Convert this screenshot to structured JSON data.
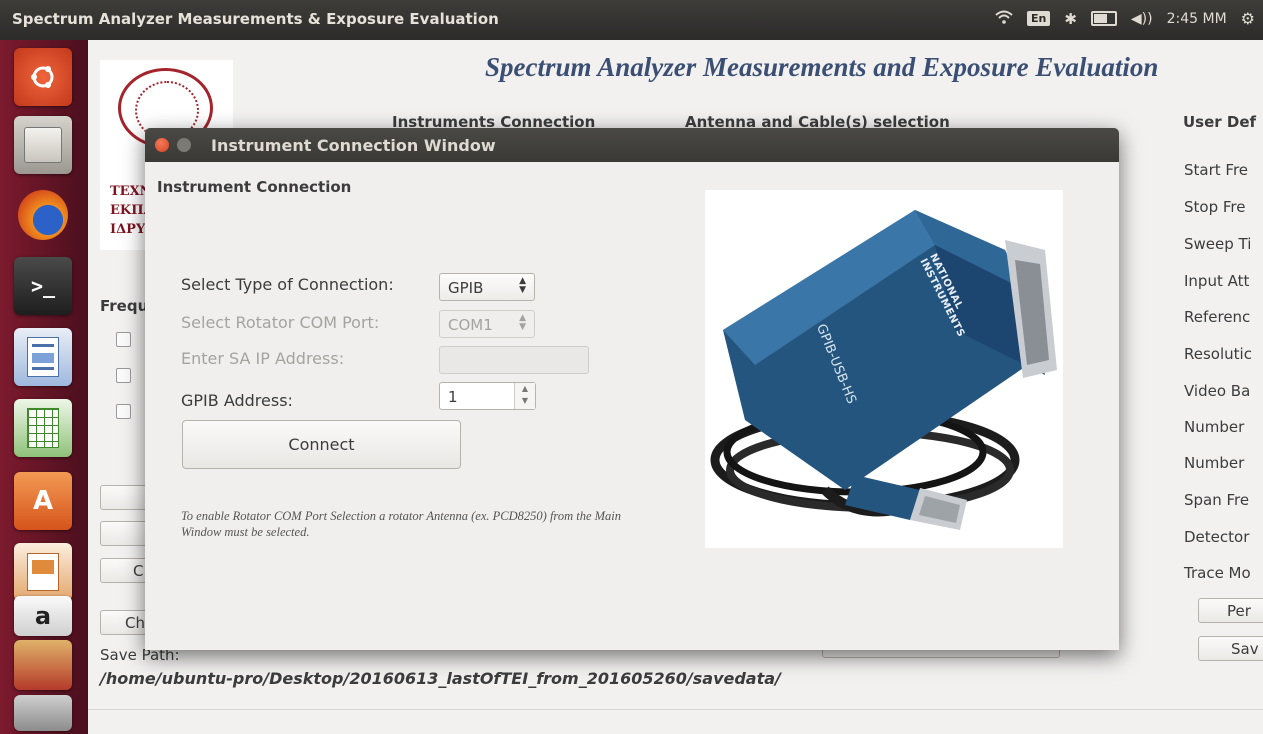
{
  "topbar": {
    "window_title": "Spectrum Analyzer Measurements & Exposure Evaluation",
    "keyboard_layout": "En",
    "clock": "2:45 MM"
  },
  "launcher": {
    "items": [
      "ubuntu-icon",
      "files-icon",
      "firefox-icon",
      "terminal-icon",
      "writer-icon",
      "calc-icon",
      "software-center-icon",
      "impress-icon",
      "amazon-icon",
      "stacked-apps-icon"
    ]
  },
  "main": {
    "title": "Spectrum Analyzer Measurements and Exposure Evaluation",
    "logo_lines": [
      "ΤΕΧΝ",
      "ΕΚΠΑ",
      "ΙΔΡΥΜ"
    ],
    "section_instruments": "Instruments Connection",
    "section_antenna": "Antenna and Cable(s) selection",
    "section_user": "User Def",
    "frequency_label": "Frequ",
    "right_labels": [
      "Start Fre",
      "Stop Fre",
      "Sweep Ti",
      "Input Att",
      "Referenc",
      "Resolutic",
      "Video Ba",
      "Number",
      "Number",
      "Span Fre",
      "Detector",
      "Trace Mo"
    ],
    "left_button_c": "C",
    "left_button_ch": "Ch",
    "right_button_per": "Per",
    "right_button_sav": "Sav",
    "save_path_label": "Save Path:",
    "save_path": "/home/ubuntu-pro/Desktop/20160613_lastOfTEI_from_201605260/savedata/"
  },
  "dialog": {
    "title": "Instrument Connection Window",
    "heading": "Instrument Connection",
    "connection_type_label": "Select Type of Connection:",
    "connection_type_value": "GPIB",
    "rotator_port_label": "Select Rotator COM Port:",
    "rotator_port_value": "COM1",
    "sa_ip_label": "Enter SA IP Address:",
    "sa_ip_value": "",
    "gpib_address_label": "GPIB Address:",
    "gpib_address_value": "1",
    "connect_label": "Connect",
    "note": "To enable Rotator COM Port Selection a rotator Antenna (ex. PCD8250) from the Main Window must be selected.",
    "device_brand": "NATIONAL INSTRUMENTS",
    "device_model": "GPIB-USB-HS"
  },
  "colors": {
    "title_blue": "#3b4f74",
    "launcher": "#6a1628",
    "close_button": "#e2583a"
  }
}
